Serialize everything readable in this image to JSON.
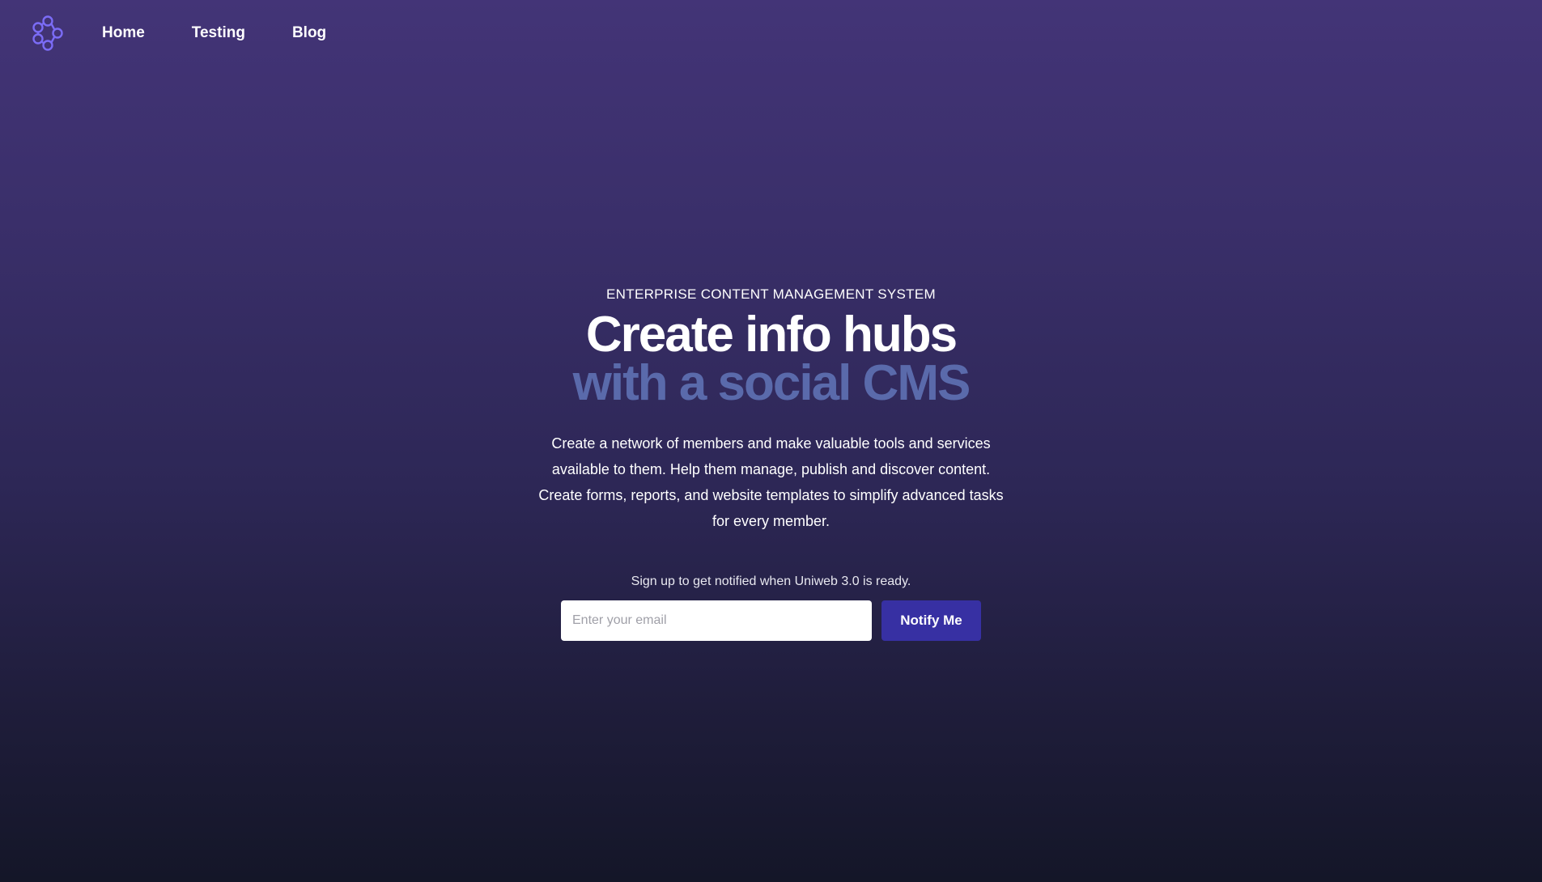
{
  "nav": {
    "logo_icon": "uniweb-network-logo-icon",
    "items": [
      {
        "label": "Home"
      },
      {
        "label": "Testing"
      },
      {
        "label": "Blog"
      }
    ]
  },
  "hero": {
    "eyebrow": "ENTERPRISE CONTENT MANAGEMENT SYSTEM",
    "headline_line1": "Create info hubs",
    "headline_line2": "with a social CMS",
    "description": "Create a network of members and make valuable tools and services available to them. Help them manage, publish and discover content. Create forms, reports, and website templates to simplify advanced tasks for every member."
  },
  "signup": {
    "note": "Sign up to get notified when Uniweb 3.0 is ready.",
    "email_placeholder": "Enter your email",
    "email_value": "",
    "button_label": "Notify Me"
  },
  "colors": {
    "background_top": "#433477",
    "background_bottom": "#141628",
    "headline_accent": "#5a6aab",
    "button": "#3730a3",
    "logo": "#6b5cf6"
  }
}
